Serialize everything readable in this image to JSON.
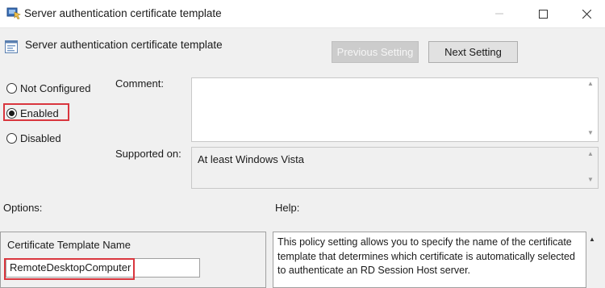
{
  "window": {
    "title": "Server authentication certificate template",
    "controls": {
      "minimize_icon": "minimize-icon",
      "maximize_icon": "maximize-icon",
      "close_icon": "close-icon"
    }
  },
  "header": {
    "title": "Server authentication certificate template",
    "buttons": {
      "previous": "Previous Setting",
      "next": "Next Setting"
    }
  },
  "state_options": [
    {
      "label": "Not Configured",
      "checked": false
    },
    {
      "label": "Enabled",
      "checked": true
    },
    {
      "label": "Disabled",
      "checked": false
    }
  ],
  "labels": {
    "comment": "Comment:",
    "supported_on": "Supported on:",
    "options": "Options:",
    "help": "Help:"
  },
  "comment_value": "",
  "supported_on_value": "At least Windows Vista",
  "options": {
    "field_label": "Certificate Template Name",
    "field_value": "RemoteDesktopComputer"
  },
  "help_text": "This policy setting allows you to specify the name of the certificate template that determines which certificate is automatically selected to authenticate an RD Session Host server.",
  "colors": {
    "highlight": "#d9363e",
    "window_bg": "#f0f0f0",
    "disabled_button": "#cccccc"
  }
}
